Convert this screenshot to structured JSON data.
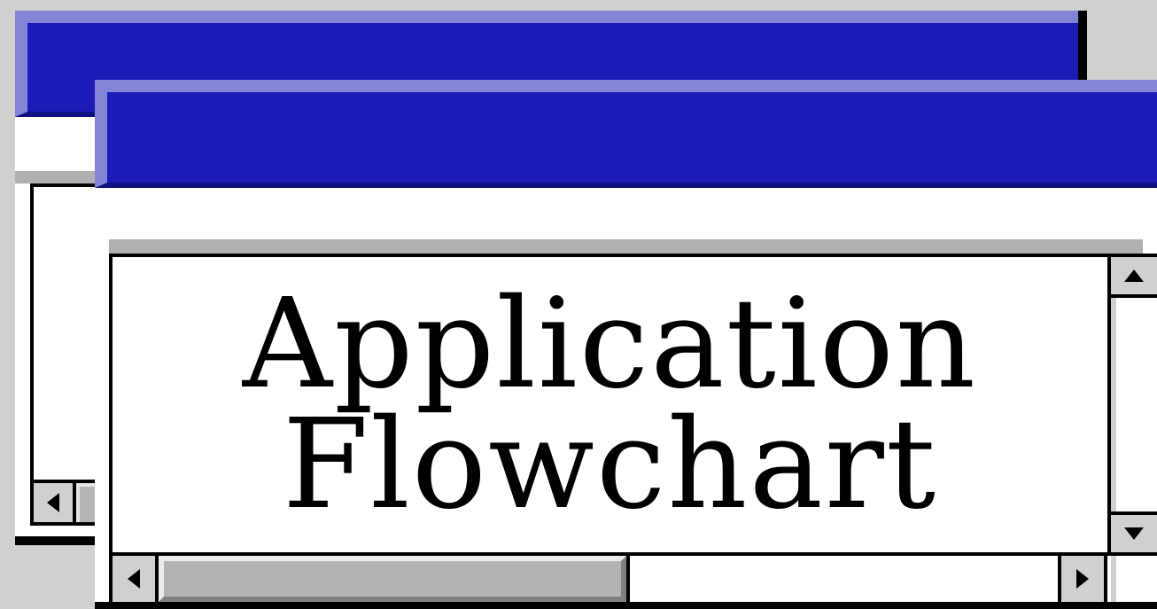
{
  "front_window": {
    "title_lines": [
      "Application",
      "Flowchart"
    ]
  },
  "icons": {
    "scroll_up": "triangle-up-icon",
    "scroll_down": "triangle-down-icon",
    "scroll_left": "triangle-left-icon",
    "scroll_right": "triangle-right-icon"
  },
  "colors": {
    "titlebar": "#1b1bb8",
    "titlebar_highlight": "#8585d8",
    "titlebar_shadow": "#111180",
    "desktop": "#d0d0d0",
    "scroll_thumb": "#b3b3b3"
  }
}
